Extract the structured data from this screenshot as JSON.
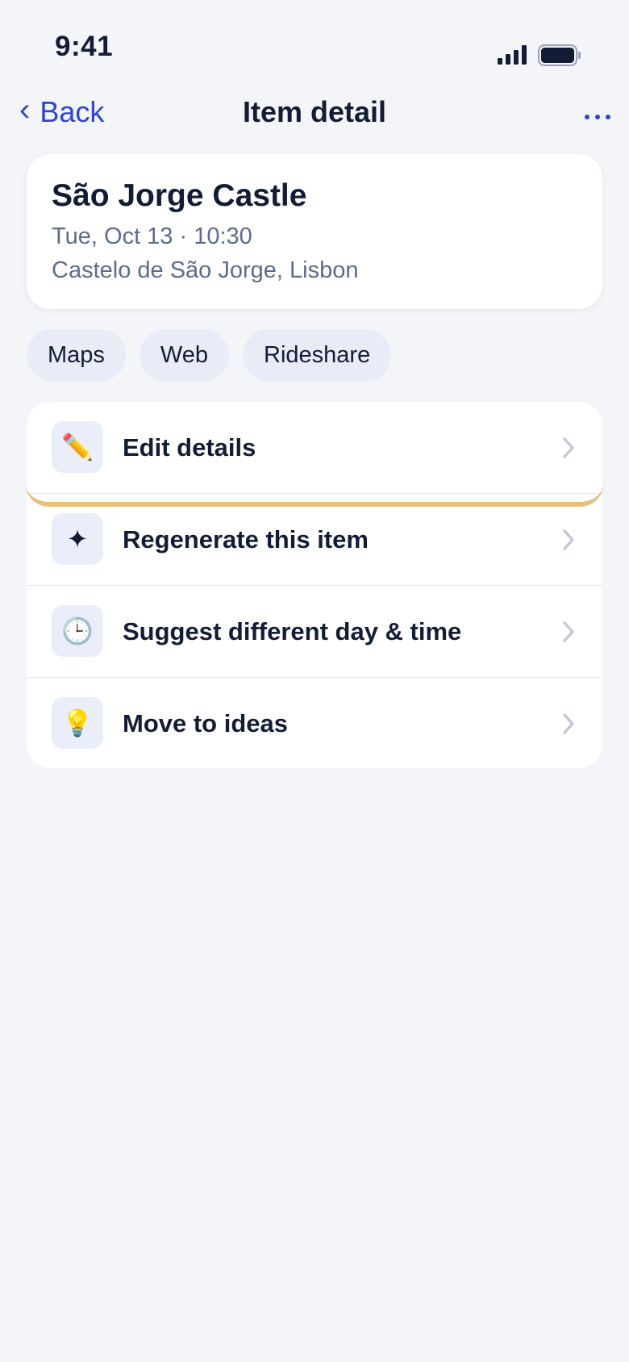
{
  "status_bar": {
    "time": "9:41"
  },
  "nav": {
    "back_label": "Back",
    "title": "Item detail"
  },
  "item": {
    "title": "São Jorge Castle",
    "datetime": "Tue, Oct 13 · 10:30",
    "location": "Castelo de São Jorge, Lisbon"
  },
  "chips": [
    "Maps",
    "Web",
    "Rideshare"
  ],
  "actions": [
    {
      "label": "Edit details",
      "icon": "pencil-icon",
      "glyph": "✏️"
    },
    {
      "label": "Regenerate this item",
      "icon": "sparkle-icon",
      "glyph": "✦"
    },
    {
      "label": "Suggest different day & time",
      "icon": "clock-icon",
      "glyph": "🕒"
    },
    {
      "label": "Move to ideas",
      "icon": "lightbulb-icon",
      "glyph": "💡"
    }
  ],
  "colors": {
    "accent": "#2c44d6",
    "background": "#f3f5f9",
    "text_primary": "#131c36",
    "text_secondary": "#5e6b8c",
    "highlight": "#e3c27a"
  }
}
